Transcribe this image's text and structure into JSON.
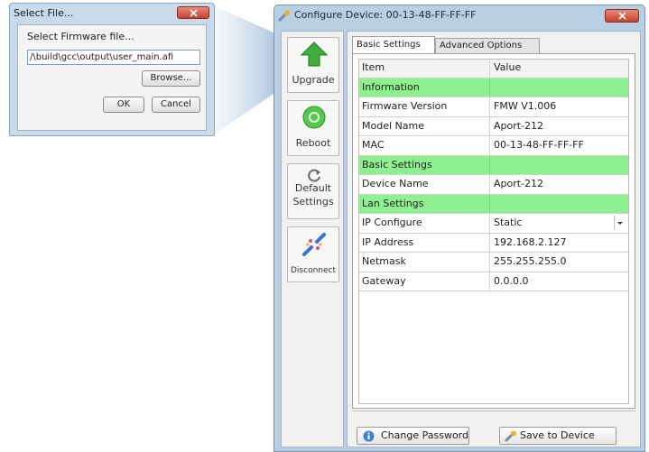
{
  "select_file_dialog": {
    "title": "Select File...",
    "label": "Select Firmware file...",
    "file_path": "/\\build\\gcc\\output\\user_main.afi",
    "browse_label": "Browse...",
    "ok_label": "OK",
    "cancel_label": "Cancel"
  },
  "configure_window": {
    "title": "Configure Device: 00-13-48-FF-FF-FF"
  },
  "toolbar": {
    "upgrade_label": "Upgrade",
    "reboot_label": "Reboot",
    "default_label_1": "Default",
    "default_label_2": "Settings",
    "disconnect_label": "Disconnect"
  },
  "tabs": {
    "basic": "Basic Settings",
    "advanced": "Advanced Options"
  },
  "table": {
    "headers": {
      "item": "Item",
      "value": "Value"
    },
    "section_information": "Information",
    "firmware_version_label": "Firmware Version",
    "firmware_version_value": "FMW V1.006",
    "model_name_label": "Model Name",
    "model_name_value": "Aport-212",
    "mac_label": "MAC",
    "mac_value": "00-13-48-FF-FF-FF",
    "section_basic": "Basic Settings",
    "device_name_label": "Device Name",
    "device_name_value": "Aport-212",
    "section_lan": "Lan Settings",
    "ip_configure_label": "IP Configure",
    "ip_configure_value": "Static",
    "ip_address_label": "IP Address",
    "ip_address_value": "192.168.2.127",
    "netmask_label": "Netmask",
    "netmask_value": "255.255.255.0",
    "gateway_label": "Gateway",
    "gateway_value": "0.0.0.0"
  },
  "actions": {
    "change_password": "Change Password",
    "save_to_device": "Save to Device"
  },
  "colors": {
    "section_row": "#8ff08f",
    "window_frame": "#b9cfe3",
    "close_button": "#c5412e"
  }
}
